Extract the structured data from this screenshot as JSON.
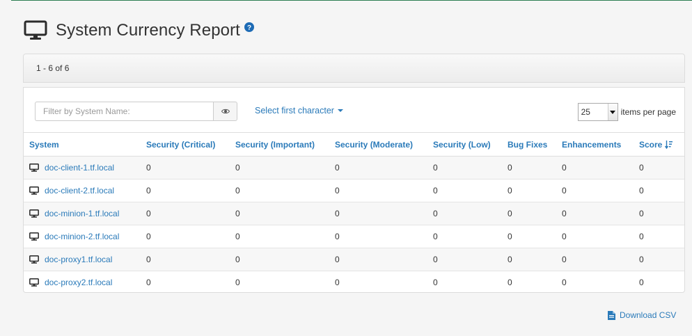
{
  "page": {
    "title": "System Currency Report",
    "title_icon": "desktop-icon",
    "help_icon": "question-circle-icon"
  },
  "summary": {
    "range_text": "1 - 6 of 6"
  },
  "filter": {
    "placeholder": "Filter by System Name:",
    "value": "",
    "eye_icon": "eye-icon",
    "char_select_label": "Select first character"
  },
  "pager": {
    "page_size": "25",
    "label": "items per page"
  },
  "table": {
    "columns": [
      "System",
      "Security (Critical)",
      "Security (Important)",
      "Security (Moderate)",
      "Security (Low)",
      "Bug Fixes",
      "Enhancements",
      "Score"
    ],
    "sort_icon": "sort-desc-icon",
    "rows": [
      {
        "system": "doc-client-1.tf.local",
        "critical": "0",
        "important": "0",
        "moderate": "0",
        "low": "0",
        "bug_fixes": "0",
        "enhancements": "0",
        "score": "0"
      },
      {
        "system": "doc-client-2.tf.local",
        "critical": "0",
        "important": "0",
        "moderate": "0",
        "low": "0",
        "bug_fixes": "0",
        "enhancements": "0",
        "score": "0"
      },
      {
        "system": "doc-minion-1.tf.local",
        "critical": "0",
        "important": "0",
        "moderate": "0",
        "low": "0",
        "bug_fixes": "0",
        "enhancements": "0",
        "score": "0"
      },
      {
        "system": "doc-minion-2.tf.local",
        "critical": "0",
        "important": "0",
        "moderate": "0",
        "low": "0",
        "bug_fixes": "0",
        "enhancements": "0",
        "score": "0"
      },
      {
        "system": "doc-proxy1.tf.local",
        "critical": "0",
        "important": "0",
        "moderate": "0",
        "low": "0",
        "bug_fixes": "0",
        "enhancements": "0",
        "score": "0"
      },
      {
        "system": "doc-proxy2.tf.local",
        "critical": "0",
        "important": "0",
        "moderate": "0",
        "low": "0",
        "bug_fixes": "0",
        "enhancements": "0",
        "score": "0"
      }
    ]
  },
  "download": {
    "label": "Download CSV",
    "icon": "file-csv-icon"
  },
  "colors": {
    "link": "#2a7ab9",
    "accent_line": "#2c7d52",
    "text": "#333333"
  }
}
